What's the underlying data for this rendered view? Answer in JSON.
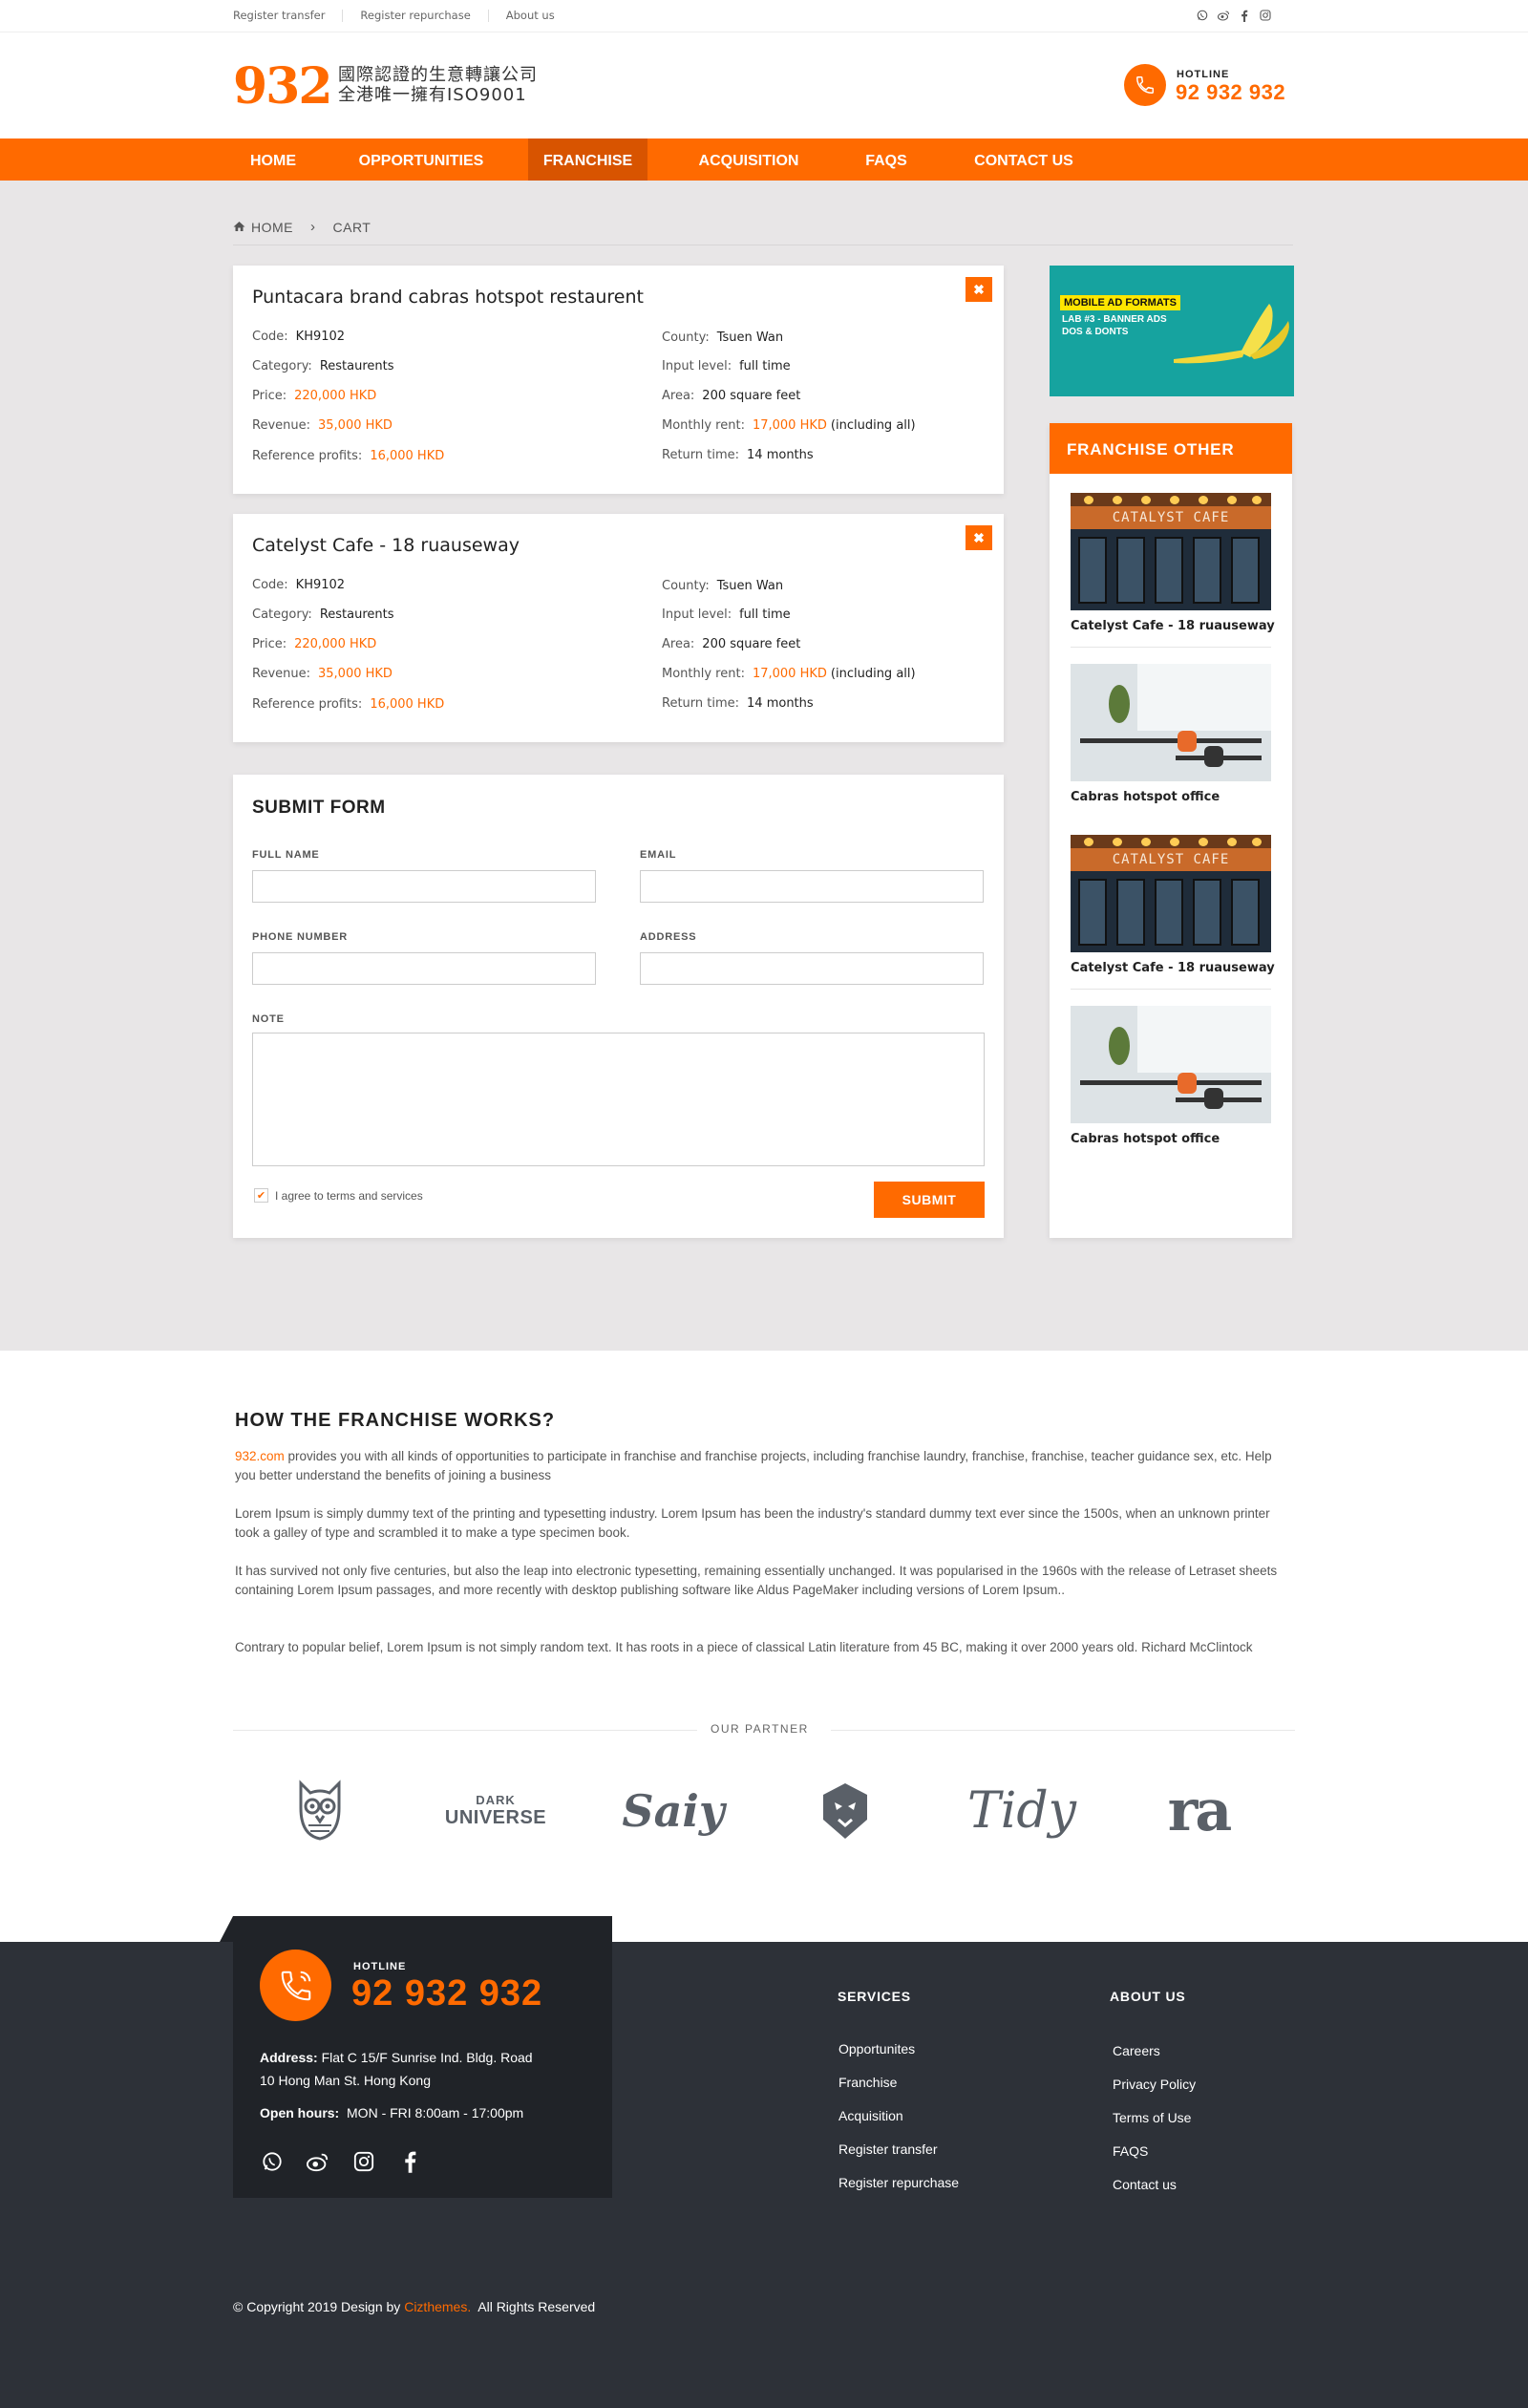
{
  "topbar": {
    "links": [
      "Register transfer",
      "Register repurchase",
      "About us"
    ],
    "social_icons": [
      "whatsapp-icon",
      "weibo-icon",
      "facebook-icon",
      "instagram-icon"
    ]
  },
  "header": {
    "logo_number": "932",
    "logo_line1": "國際認證的生意轉讓公司",
    "logo_line2": "全港唯一擁有ISO9001",
    "hotline_label": "HOTLINE",
    "hotline_number": "92 932 932"
  },
  "nav": {
    "items": [
      "HOME",
      "OPPORTUNITIES",
      "FRANCHISE",
      "ACQUISITION",
      "FAQS",
      "CONTACT US"
    ],
    "active": "FRANCHISE"
  },
  "breadcrumb": {
    "home": "HOME",
    "separator": "›",
    "current": "CART"
  },
  "cart": {
    "items": [
      {
        "title": "Puntacara brand cabras hotspot restaurent",
        "code_label": "Code:",
        "code": "KH9102",
        "category_label": "Category:",
        "category": "Restaurents",
        "price_label": "Price:",
        "price": "220,000 HKD",
        "revenue_label": "Revenue:",
        "revenue": "35,000 HKD",
        "profits_label": "Reference profits:",
        "profits": "16,000 HKD",
        "county_label": "County:",
        "county": "Tsuen Wan",
        "input_label": "Input level:",
        "input": "full time",
        "area_label": "Area:",
        "area": "200 square feet",
        "rent_label": "Monthly rent:",
        "rent": "17,000 HKD",
        "rent_note": "(including all)",
        "return_label": "Return time:",
        "return": "14 months"
      },
      {
        "title": "Catelyst Cafe - 18 ruauseway",
        "code_label": "Code:",
        "code": "KH9102",
        "category_label": "Category:",
        "category": "Restaurents",
        "price_label": "Price:",
        "price": "220,000 HKD",
        "revenue_label": "Revenue:",
        "revenue": "35,000 HKD",
        "profits_label": "Reference profits:",
        "profits": "16,000 HKD",
        "county_label": "County:",
        "county": "Tsuen Wan",
        "input_label": "Input level:",
        "input": "full time",
        "area_label": "Area:",
        "area": "200 square feet",
        "rent_label": "Monthly rent:",
        "rent": "17,000 HKD",
        "rent_note": "(including all)",
        "return_label": "Return time:",
        "return": "14 months"
      }
    ]
  },
  "form": {
    "title": "SUBMIT FORM",
    "full_name_label": "FULL NAME",
    "email_label": "EMAIL",
    "phone_label": "PHONE NUMBER",
    "address_label": "ADDRESS",
    "note_label": "NOTE",
    "full_name_value": "",
    "email_value": "",
    "phone_value": "",
    "address_value": "",
    "note_value": "",
    "agree_label": "I agree to terms and services",
    "agree_checked": true,
    "submit_label": "SUBMIT"
  },
  "sidebar": {
    "ad": {
      "title": "MOBILE AD FORMATS",
      "line1": "LAB #3 - BANNER ADS",
      "line2": "DOS & DONTS"
    },
    "panel_title": "FRANCHISE OTHER",
    "items": [
      {
        "caption": "Catelyst Cafe - 18 ruauseway",
        "image": "cafe",
        "sign": "CATALYST CAFE"
      },
      {
        "caption": "Cabras hotspot office",
        "image": "office"
      },
      {
        "caption": "Catelyst Cafe - 18 ruauseway",
        "image": "cafe",
        "sign": "CATALYST CAFE"
      },
      {
        "caption": "Cabras hotspot office",
        "image": "office"
      }
    ]
  },
  "info": {
    "title": "HOW THE FRANCHISE WORKS?",
    "p1_link": "932.com",
    "p1_rest": " provides you with all kinds of opportunities to participate in franchise and franchise projects, including franchise laundry, franchise, franchise, teacher guidance sex, etc. Help you better understand the benefits of joining a business",
    "p2": "Lorem Ipsum is simply dummy text of the printing and typesetting industry. Lorem Ipsum has been the industry's standard dummy text ever since the 1500s, when an unknown printer took a galley of type and scrambled it to make a type specimen book.",
    "p3": "It has survived not only five centuries, but also the leap into electronic typesetting, remaining essentially unchanged. It was popularised in the 1960s with the release of Letraset sheets containing Lorem Ipsum passages, and more recently with desktop publishing software like Aldus PageMaker including versions of Lorem Ipsum..",
    "p4": "Contrary to popular belief, Lorem Ipsum is not simply random text. It has roots in a piece of classical Latin literature from 45 BC, making it over 2000 years old. Richard McClintock"
  },
  "partners": {
    "label": "OUR PARTNER",
    "logos": [
      {
        "icon": "owl-logo-icon"
      },
      {
        "text_line1": "DARK",
        "text_line2": "UNIVERSE"
      },
      {
        "text": "Saiy"
      },
      {
        "icon": "lion-logo-icon"
      },
      {
        "text": "Tidy"
      },
      {
        "text": "ra"
      }
    ]
  },
  "footer": {
    "hotline_label": "HOTLINE",
    "hotline_number": "92 932 932",
    "address_label": "Address:",
    "address_line1": "Flat C 15/F Sunrise Ind. Bldg.  Road",
    "address_line2": "10 Hong Man St. Hong Kong",
    "hours_label": "Open hours:",
    "hours": "MON - FRI  8:00am - 17:00pm",
    "social_icons": [
      "whatsapp-icon",
      "weibo-icon",
      "instagram-icon",
      "facebook-icon"
    ],
    "services_title": "SERVICES",
    "services": [
      "Opportunites",
      "Franchise",
      "Acquisition",
      "Register transfer",
      "Register repurchase"
    ],
    "about_title": "ABOUT US",
    "about": [
      "Careers",
      "Privacy Policy",
      "Terms of Use",
      "FAQS",
      "Contact us"
    ],
    "copyright_pre": "© Copyright 2019 Design by ",
    "copyright_brand": "Cizthemes.",
    "copyright_post": "  All Rights Reserved"
  },
  "colors": {
    "accent": "#ff6a00",
    "nav_active": "#d85400",
    "footer_bg": "#2d3138",
    "page_bg": "#e8e6e7"
  }
}
